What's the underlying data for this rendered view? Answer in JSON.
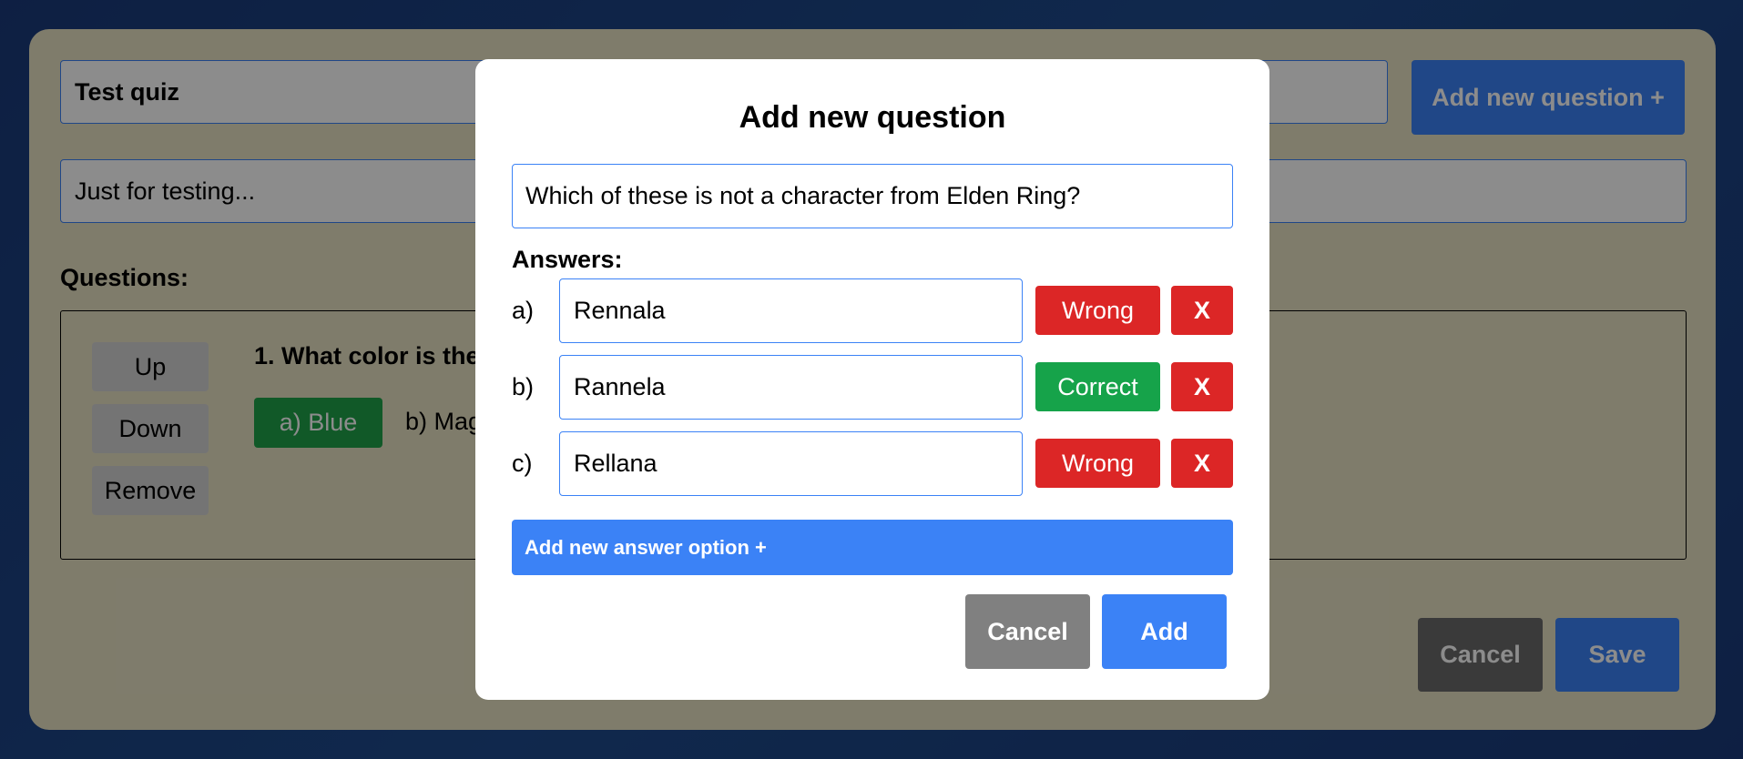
{
  "editor": {
    "quiz_title": "Test quiz",
    "quiz_description": "Just for testing...",
    "add_question_label": "Add new question +",
    "questions_label": "Questions:",
    "question": {
      "controls": {
        "up": "Up",
        "down": "Down",
        "remove": "Remove"
      },
      "title": "1. What color is the",
      "answers": [
        {
          "label": "a) Blue",
          "color": "#1fa34a"
        },
        {
          "label": "b) Mag"
        }
      ]
    },
    "cancel_label": "Cancel",
    "save_label": "Save"
  },
  "modal": {
    "title": "Add new question",
    "question_text": "Which of these is not a character from Elden Ring?",
    "answers_label": "Answers:",
    "answers": [
      {
        "letter": "a)",
        "text": "Rennala",
        "status": "Wrong",
        "status_color": "#dc2626",
        "remove": "X"
      },
      {
        "letter": "b)",
        "text": "Rannela",
        "status": "Correct",
        "status_color": "#16a34a",
        "remove": "X"
      },
      {
        "letter": "c)",
        "text": "Rellana",
        "status": "Wrong",
        "status_color": "#dc2626",
        "remove": "X"
      }
    ],
    "add_answer_label": "Add new answer option +",
    "cancel_label": "Cancel",
    "add_label": "Add"
  }
}
